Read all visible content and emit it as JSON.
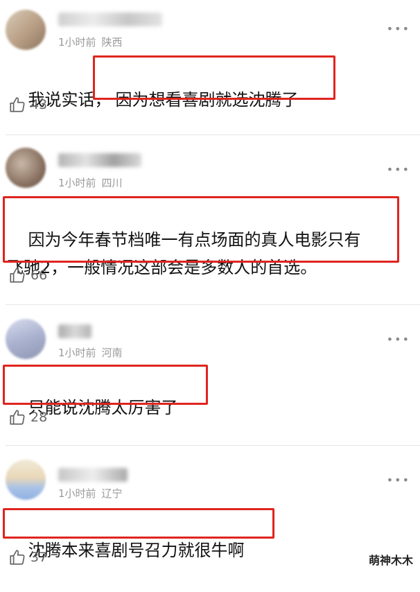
{
  "comments": [
    {
      "time": "1小时前",
      "region": "陕西",
      "text_prefix": "我说实话，",
      "text_highlight": "因为想看喜剧就选沈腾了",
      "likes": "43",
      "more": "•••"
    },
    {
      "time": "1小时前",
      "region": "四川",
      "text_highlight": "因为今年春节档唯一有点场面的真人电影只有\n飞驰2，一般情况这部会是多数人的首选。",
      "likes": "66",
      "more": "•••"
    },
    {
      "time": "1小时前",
      "region": "河南",
      "text_highlight": "只能说沈腾太厉害了",
      "likes": "28",
      "more": "•••"
    },
    {
      "time": "1小时前",
      "region": "辽宁",
      "text_highlight": "沈腾本来喜剧号召力就很牛啊",
      "likes": "37",
      "more": "•••"
    }
  ],
  "watermark": "萌神木木",
  "colors": {
    "highlight_border": "#e0241e",
    "meta_text": "#9a9a9a"
  }
}
